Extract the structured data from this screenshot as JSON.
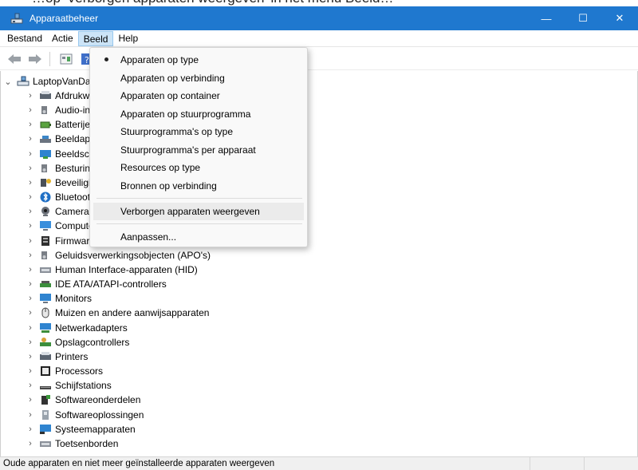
{
  "caption_fragment": "…op 'Verborgen apparaten weergeven' in het menu Beeld…",
  "window": {
    "title": "Apparaatbeheer",
    "controls": {
      "minimize": "—",
      "maximize": "☐",
      "close": "✕"
    }
  },
  "menubar": {
    "items": [
      {
        "label": "Bestand"
      },
      {
        "label": "Actie"
      },
      {
        "label": "Beeld"
      },
      {
        "label": "Help"
      }
    ]
  },
  "toolbar": {
    "buttons": [
      "back-icon",
      "forward-icon",
      "properties-icon",
      "help-icon"
    ]
  },
  "tree": {
    "root": "LaptopVanDaniel",
    "nodes": [
      "Afdrukwachtrijen",
      "Audio-invoer en -uitvoer",
      "Batterijen",
      "Beeldapparaten",
      "Beeldschermadapters",
      "Besturing voor geluid, video en games",
      "Beveiligingsapparaten",
      "Bluetooth",
      "Camera's",
      "Computer",
      "Firmware",
      "Geluidsverwerkingsobjecten (APO's)",
      "Human Interface-apparaten (HID)",
      "IDE ATA/ATAPI-controllers",
      "Monitors",
      "Muizen en andere aanwijsapparaten",
      "Netwerkadapters",
      "Opslagcontrollers",
      "Printers",
      "Processors",
      "Schijfstations",
      "Softwareonderdelen",
      "Softwareoplossingen",
      "Systeemapparaten",
      "Toetsenborden"
    ]
  },
  "dropdown": {
    "group1": [
      "Apparaten op type",
      "Apparaten op verbinding",
      "Apparaten op container",
      "Apparaten op stuurprogramma",
      "Stuurprogramma's op type",
      "Stuurprogramma's per apparaat",
      "Resources op type",
      "Bronnen op verbinding"
    ],
    "hidden_devices": "Verborgen apparaten weergeven",
    "customize": "Aanpassen..."
  },
  "statusbar": {
    "text": "Oude apparaten en niet meer geïnstalleerde apparaten weergeven"
  },
  "colors": {
    "titlebar": "#1f78cf",
    "menu_active": "#cce4f7",
    "highlight": "#ebebeb"
  }
}
